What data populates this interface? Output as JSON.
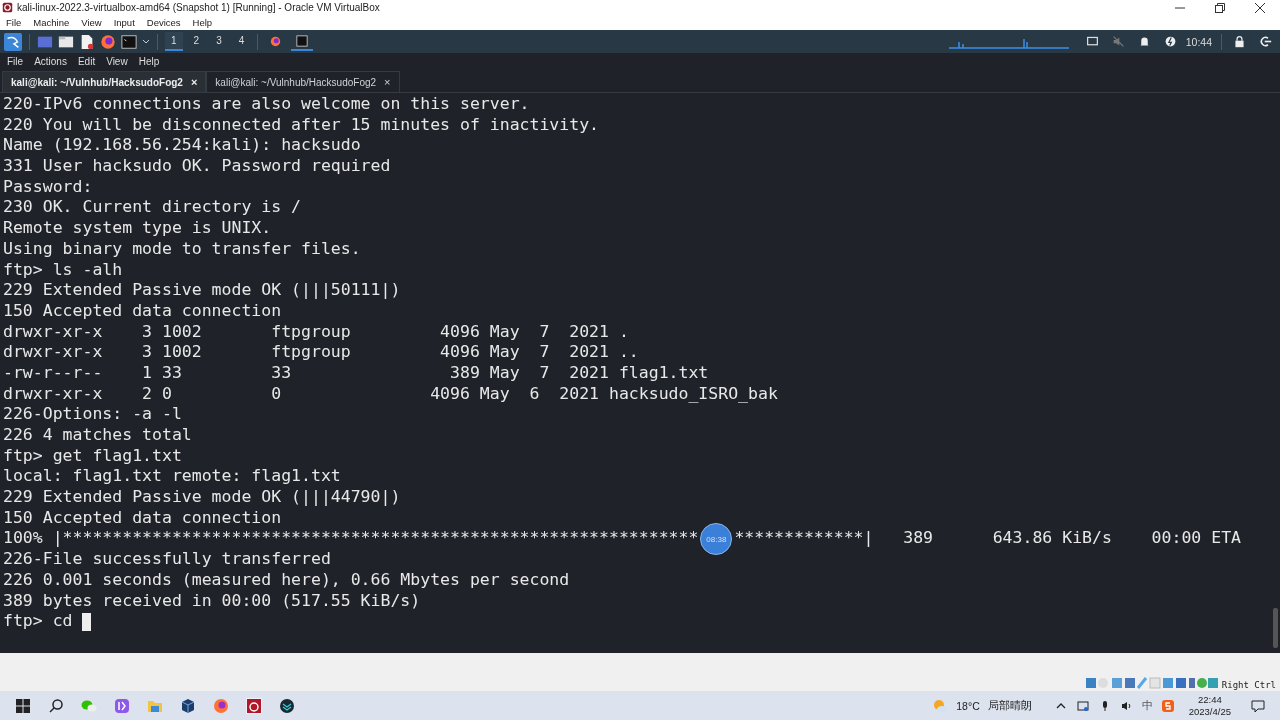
{
  "window": {
    "title": "kali-linux-2022.3-virtualbox-amd64 (Snapshot 1) [Running] - Oracle VM VirtualBox"
  },
  "menu": [
    "File",
    "Machine",
    "View",
    "Input",
    "Devices",
    "Help"
  ],
  "kali_panel": {
    "workspaces": [
      {
        "label": "1",
        "selected": true
      },
      {
        "label": "2",
        "selected": false
      },
      {
        "label": "3",
        "selected": false
      },
      {
        "label": "4",
        "selected": false
      }
    ],
    "clock": "10:44"
  },
  "terminal": {
    "menu": [
      "File",
      "Actions",
      "Edit",
      "View",
      "Help"
    ],
    "tabs": [
      {
        "label": "kali@kali: ~/Vulnhub/HacksudoFog2",
        "close": "×",
        "selected": true
      },
      {
        "label": "kali@kali: ~/Vulnhub/HacksudoFog2",
        "close": "×",
        "selected": false
      }
    ],
    "lines": [
      {
        "kind": "text",
        "text": "220-IPv6 connections are also welcome on this server."
      },
      {
        "kind": "text",
        "text": "220 You will be disconnected after 15 minutes of inactivity."
      },
      {
        "kind": "text",
        "text": "Name (192.168.56.254:kali): hacksudo"
      },
      {
        "kind": "text",
        "text": "331 User hacksudo OK. Password required"
      },
      {
        "kind": "text",
        "text": "Password:"
      },
      {
        "kind": "text",
        "text": "230 OK. Current directory is /"
      },
      {
        "kind": "text",
        "text": "Remote system type is UNIX."
      },
      {
        "kind": "text",
        "text": "Using binary mode to transfer files."
      },
      {
        "kind": "text",
        "text": "ftp> ls -alh"
      },
      {
        "kind": "text",
        "text": "229 Extended Passive mode OK (|||50111|)"
      },
      {
        "kind": "text",
        "text": "150 Accepted data connection"
      },
      {
        "kind": "text",
        "text": "drwxr-xr-x    3 1002       ftpgroup         4096 May  7  2021 ."
      },
      {
        "kind": "text",
        "text": "drwxr-xr-x    3 1002       ftpgroup         4096 May  7  2021 .."
      },
      {
        "kind": "text",
        "text": "-rw-r--r--    1 33         33                389 May  7  2021 flag1.txt"
      },
      {
        "kind": "text",
        "text": "drwxr-xr-x    2 0          0               4096 May  6  2021 hacksudo_ISRO_bak"
      },
      {
        "kind": "text",
        "text": "226-Options: -a -l"
      },
      {
        "kind": "text",
        "text": "226 4 matches total"
      },
      {
        "kind": "text",
        "text": "ftp> get flag1.txt"
      },
      {
        "kind": "text",
        "text": "local: flag1.txt remote: flag1.txt"
      },
      {
        "kind": "text",
        "text": "229 Extended Passive mode OK (|||44790|)"
      },
      {
        "kind": "text",
        "text": "150 Accepted data connection"
      },
      {
        "kind": "progress",
        "before": "100% |****************************************************************",
        "badge": "08:38",
        "after": "*************|   389      643.86 KiB/s    00:00 ETA"
      },
      {
        "kind": "text",
        "text": "226-File successfully transferred"
      },
      {
        "kind": "text",
        "text": "226 0.001 seconds (measured here), 0.66 Mbytes per second"
      },
      {
        "kind": "text",
        "text": "389 bytes received in 00:00 (517.55 KiB/s)"
      },
      {
        "kind": "prompt",
        "text": "ftp> cd "
      }
    ]
  },
  "vbox_status": {
    "host_key": "Right Ctrl"
  },
  "taskbar": {
    "temperature": "18°C",
    "weather": "局部晴朗",
    "ime": "中",
    "time": "22:44",
    "date": "2023/4/25"
  }
}
